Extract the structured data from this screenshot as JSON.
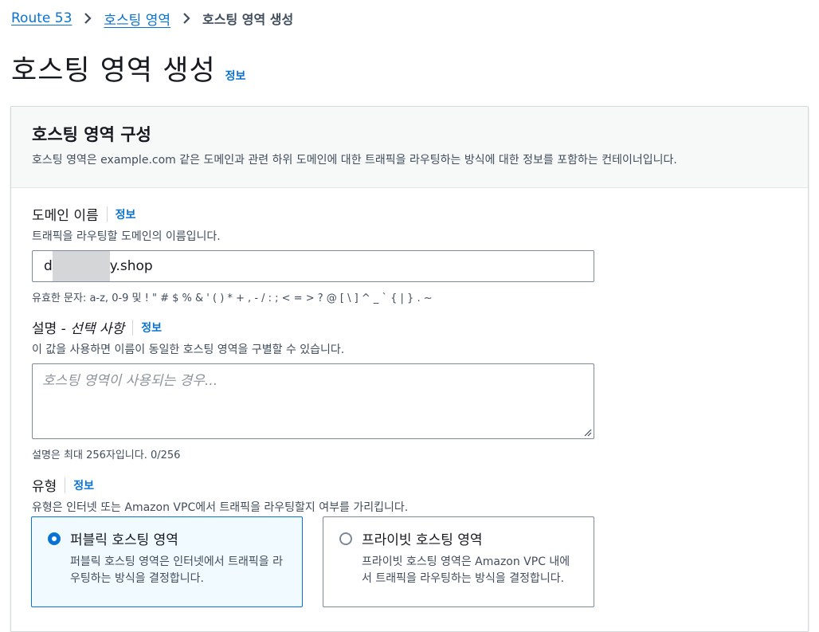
{
  "breadcrumb": {
    "items": [
      "Route 53",
      "호스팅 영역"
    ],
    "current": "호스팅 영역 생성"
  },
  "page": {
    "title": "호스팅 영역 생성",
    "info": "정보"
  },
  "panel": {
    "title": "호스팅 영역 구성",
    "description": "호스팅 영역은 example.com 같은 도메인과 관련 하위 도메인에 대한 트래픽을 라우팅하는 방식에 대한 정보를 포함하는 컨테이너입니다."
  },
  "domain": {
    "label": "도메인 이름",
    "info": "정보",
    "description": "트래픽을 라우팅할 도메인의 이름입니다.",
    "value_prefix": "d",
    "value_suffix": "y.shop",
    "constraint": "유효한 문자: a-z, 0-9 및 ! \" # $ % & ' ( ) * + , - / : ; < = > ? @ [ \\ ] ^ _ ` { | } . ~"
  },
  "comment": {
    "label": "설명 - ",
    "label_optional": "선택 사항",
    "info": "정보",
    "description": "이 값을 사용하면 이름이 동일한 호스팅 영역을 구별할 수 있습니다.",
    "placeholder": "호스팅 영역이 사용되는 경우...",
    "constraint": "설명은 최대 256자입니다. 0/256"
  },
  "type": {
    "label": "유형",
    "info": "정보",
    "description": "유형은 인터넷 또는 Amazon VPC에서 트래픽을 라우팅할지 여부를 가리킵니다.",
    "options": [
      {
        "title": "퍼블릭 호스팅 영역",
        "description": "퍼블릭 호스팅 영역은 인터넷에서 트래픽을 라우팅하는 방식을 결정합니다.",
        "selected": true
      },
      {
        "title": "프라이빗 호스팅 영역",
        "description": "프라이빗 호스팅 영역은 Amazon VPC 내에서 트래픽을 라우팅하는 방식을 결정합니다.",
        "selected": false
      }
    ]
  },
  "colors": {
    "link": "#0972d3",
    "selected_tile_bg": "#f1faff",
    "border": "#7d8998"
  }
}
